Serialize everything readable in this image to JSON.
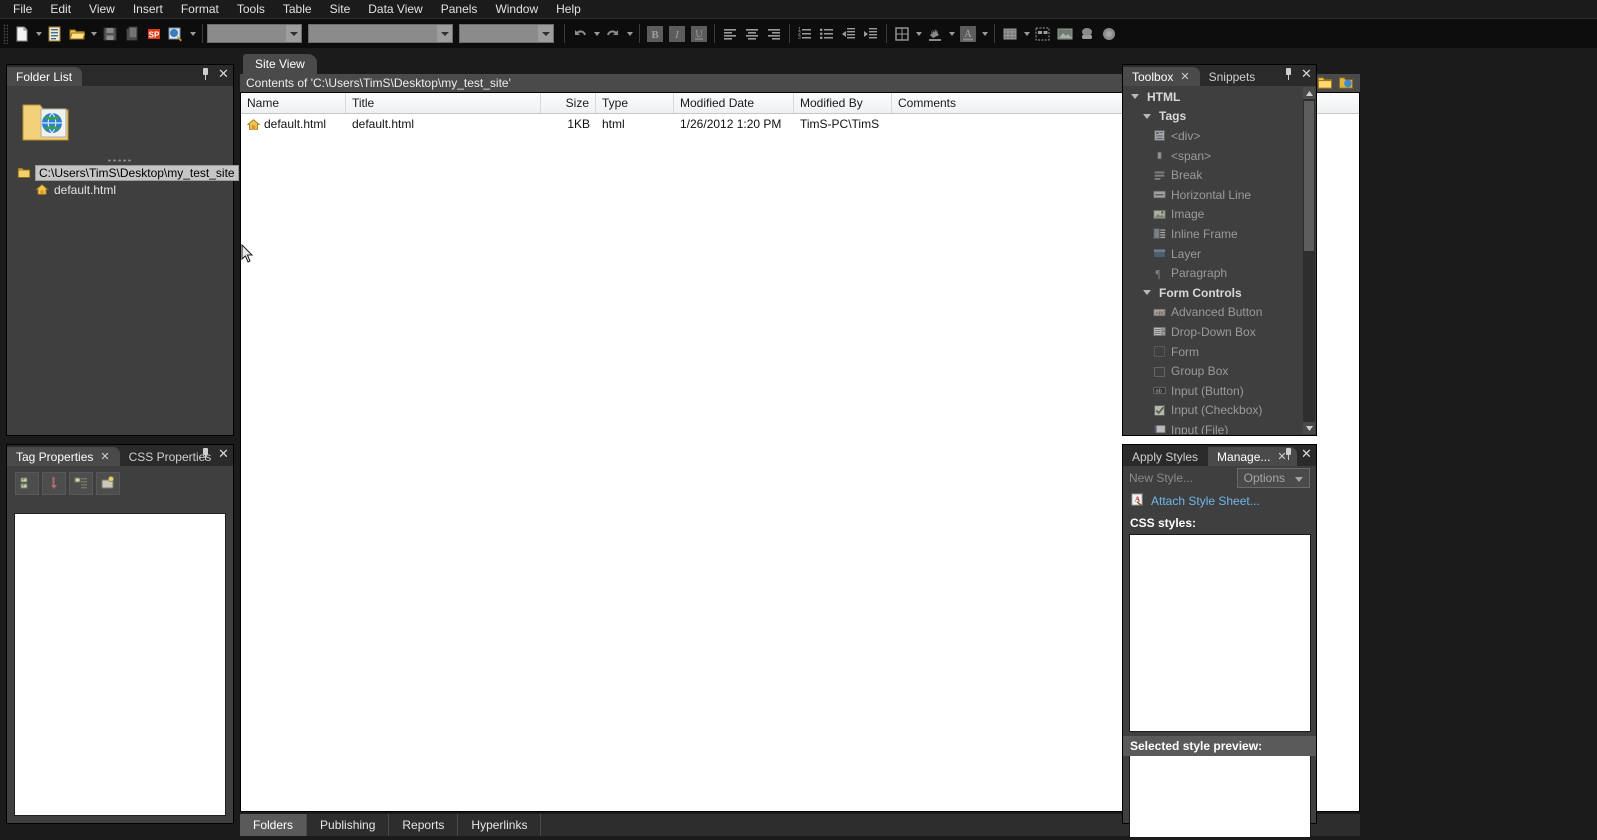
{
  "menu": {
    "items": [
      "File",
      "Edit",
      "View",
      "Insert",
      "Format",
      "Tools",
      "Table",
      "Site",
      "Data View",
      "Panels",
      "Window",
      "Help"
    ]
  },
  "toolbar": {
    "buttons": [
      {
        "name": "new-page-icon",
        "label": "New"
      },
      {
        "name": "new-web-page-icon",
        "label": "New Web Page"
      },
      {
        "name": "open-folder-icon",
        "label": "Open"
      },
      {
        "name": "save-icon",
        "label": "Save"
      },
      {
        "name": "publish-site-icon",
        "label": "Publish Site"
      },
      {
        "name": "sharepoint-icon",
        "label": "SP"
      },
      {
        "name": "preview-in-browser-icon",
        "label": "Preview in Browser"
      },
      {
        "name": "undo-icon",
        "label": "Undo"
      },
      {
        "name": "redo-icon",
        "label": "Redo"
      },
      {
        "name": "bold-icon",
        "label": "B"
      },
      {
        "name": "italic-icon",
        "label": "I"
      },
      {
        "name": "underline-icon",
        "label": "U"
      },
      {
        "name": "align-left-icon",
        "label": "Align Left"
      },
      {
        "name": "align-center-icon",
        "label": "Center"
      },
      {
        "name": "align-right-icon",
        "label": "Align Right"
      },
      {
        "name": "numbered-list-icon",
        "label": "Numbered List"
      },
      {
        "name": "bullet-list-icon",
        "label": "Bullets"
      },
      {
        "name": "decrease-indent-icon",
        "label": "Decrease Indent"
      },
      {
        "name": "increase-indent-icon",
        "label": "Increase Indent"
      },
      {
        "name": "borders-icon",
        "label": "Borders"
      },
      {
        "name": "highlight-icon",
        "label": "Highlight"
      },
      {
        "name": "font-color-icon",
        "label": "Font Color"
      },
      {
        "name": "insert-table-icon",
        "label": "Insert Table"
      },
      {
        "name": "insert-layer-icon",
        "label": "Insert Layer"
      },
      {
        "name": "insert-picture-icon",
        "label": "Insert Picture"
      },
      {
        "name": "insert-hyperlink-icon",
        "label": "Hyperlink"
      },
      {
        "name": "web-component-icon",
        "label": "Web Component"
      }
    ],
    "combos": [
      {
        "name": "style-combo",
        "value": ""
      },
      {
        "name": "font-combo",
        "value": ""
      },
      {
        "name": "font-size-combo",
        "value": ""
      }
    ]
  },
  "folder_list": {
    "tab_title": "Folder List",
    "tree": [
      {
        "label": "C:\\Users\\TimS\\Desktop\\my_test_site",
        "icon": "folder-icon",
        "selected": true
      },
      {
        "label": "default.html",
        "icon": "home-page-icon",
        "selected": false
      }
    ]
  },
  "tag_properties": {
    "tabs": [
      {
        "label": "Tag Properties",
        "active": true,
        "closable": true
      },
      {
        "label": "CSS Properties",
        "active": false,
        "closable": false
      }
    ],
    "toolbar_buttons": [
      {
        "name": "show-set-properties-button"
      },
      {
        "name": "show-all-properties-button"
      },
      {
        "name": "show-categorized-button"
      },
      {
        "name": "show-alphabetized-button"
      }
    ]
  },
  "site_view": {
    "tab_label": "Site View",
    "contents_label": "Contents of 'C:\\Users\\TimS\\Desktop\\my_test_site'",
    "header_icons": [
      {
        "name": "new-page-icon"
      },
      {
        "name": "new-folder-icon"
      },
      {
        "name": "new-subsite-icon"
      }
    ],
    "columns": [
      "Name",
      "Title",
      "Size",
      "Type",
      "Modified Date",
      "Modified By",
      "Comments"
    ],
    "rows": [
      {
        "icon": "home-page-icon",
        "name": "default.html",
        "title": "default.html",
        "size": "1KB",
        "type": "html",
        "modified_date": "1/26/2012 1:20 PM",
        "modified_by": "TimS-PC\\TimS",
        "comments": ""
      }
    ],
    "bottom_tabs": [
      {
        "label": "Folders",
        "active": true
      },
      {
        "label": "Publishing",
        "active": false
      },
      {
        "label": "Reports",
        "active": false
      },
      {
        "label": "Hyperlinks",
        "active": false
      }
    ]
  },
  "toolbox": {
    "tabs": [
      {
        "label": "Toolbox",
        "active": true,
        "closable": true
      },
      {
        "label": "Snippets",
        "active": false,
        "closable": false
      }
    ],
    "items": [
      {
        "label": "HTML",
        "level": 0,
        "type": "group",
        "expanded": true
      },
      {
        "label": "Tags",
        "level": 1,
        "type": "group",
        "expanded": true
      },
      {
        "label": "<div>",
        "level": 2,
        "type": "item",
        "icon": "div-tag-icon"
      },
      {
        "label": "<span>",
        "level": 2,
        "type": "item",
        "icon": "span-tag-icon"
      },
      {
        "label": "Break",
        "level": 2,
        "type": "item",
        "icon": "break-icon"
      },
      {
        "label": "Horizontal Line",
        "level": 2,
        "type": "item",
        "icon": "horizontal-line-icon"
      },
      {
        "label": "Image",
        "level": 2,
        "type": "item",
        "icon": "image-icon"
      },
      {
        "label": "Inline Frame",
        "level": 2,
        "type": "item",
        "icon": "inline-frame-icon"
      },
      {
        "label": "Layer",
        "level": 2,
        "type": "item",
        "icon": "layer-icon"
      },
      {
        "label": "Paragraph",
        "level": 2,
        "type": "item",
        "icon": "paragraph-icon"
      },
      {
        "label": "Form Controls",
        "level": 1,
        "type": "group",
        "expanded": true
      },
      {
        "label": "Advanced Button",
        "level": 2,
        "type": "item",
        "icon": "advanced-button-icon"
      },
      {
        "label": "Drop-Down Box",
        "level": 2,
        "type": "item",
        "icon": "drop-down-box-icon"
      },
      {
        "label": "Form",
        "level": 2,
        "type": "item",
        "icon": "form-icon"
      },
      {
        "label": "Group Box",
        "level": 2,
        "type": "item",
        "icon": "group-box-icon"
      },
      {
        "label": "Input (Button)",
        "level": 2,
        "type": "item",
        "icon": "input-button-icon"
      },
      {
        "label": "Input (Checkbox)",
        "level": 2,
        "type": "item",
        "icon": "input-checkbox-icon"
      },
      {
        "label": "Input (File)",
        "level": 2,
        "type": "item",
        "icon": "input-file-icon"
      }
    ]
  },
  "manage_styles": {
    "tabs": [
      {
        "label": "Apply Styles",
        "active": false,
        "closable": false
      },
      {
        "label": "Manage...",
        "active": true,
        "closable": true
      }
    ],
    "new_style_label": "New Style...",
    "options_label": "Options",
    "attach_style_sheet_label": "Attach Style Sheet...",
    "css_styles_label": "CSS styles:",
    "css_styles_items": [],
    "selected_style_preview_label": "Selected style preview:"
  },
  "colors": {
    "panel_bg": "#3f3f3f",
    "app_bg": "#1b1b1b",
    "tab_active": "#4a4a4a",
    "link": "#6fb6e8",
    "selection": "#c6c6c6"
  }
}
